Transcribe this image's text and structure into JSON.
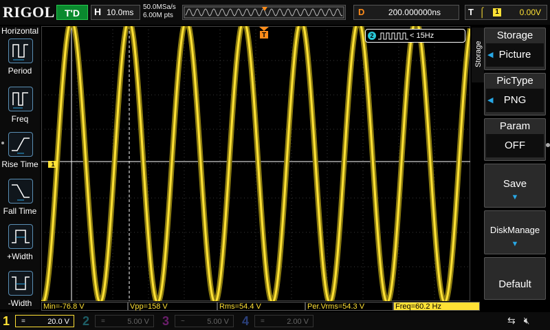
{
  "brand": "RIGOL",
  "run_status": "T'D",
  "horizontal": {
    "label": "H",
    "timebase": "10.0ms"
  },
  "acquisition": {
    "sample_rate": "50.0MSa/s",
    "memory_depth": "6.00M pts"
  },
  "delay": {
    "label": "D",
    "value": "200.000000ns"
  },
  "trigger": {
    "label": "T",
    "edge": "rising",
    "source": "1",
    "level": "0.00V"
  },
  "left_menu": {
    "title": "Horizontal",
    "items": [
      {
        "label": "Period",
        "icon": "period-icon"
      },
      {
        "label": "Freq",
        "icon": "frequency-icon"
      },
      {
        "label": "Rise Time",
        "icon": "rise-time-icon"
      },
      {
        "label": "Fall Time",
        "icon": "fall-time-icon"
      },
      {
        "label": "+Width",
        "icon": "positive-width-icon"
      },
      {
        "label": "-Width",
        "icon": "negative-width-icon"
      }
    ]
  },
  "screen": {
    "trigger_marker": "T",
    "ch1_marker": "1",
    "ch2_counter": {
      "channel": "2",
      "text": "< 15Hz"
    }
  },
  "right_menu": {
    "tab": "Storage",
    "storage": {
      "title": "Storage",
      "value": "Picture"
    },
    "pictype": {
      "title": "PicType",
      "value": "PNG"
    },
    "param": {
      "title": "Param",
      "value": "OFF"
    },
    "save": "Save",
    "disk": "DiskManage",
    "default": "Default"
  },
  "measurements": [
    {
      "text": "Min=-76.8 V",
      "highlight": false
    },
    {
      "text": "Vpp=158 V",
      "highlight": false
    },
    {
      "text": "Rms=54.4 V",
      "highlight": false
    },
    {
      "text": "Per.Vrms=54.3 V",
      "highlight": false
    },
    {
      "text": "Freq=60.2 Hz",
      "highlight": true
    }
  ],
  "channels": [
    {
      "num": "1",
      "coupling": "=",
      "scale": "20.0 V",
      "active": true,
      "color": "#ffe135"
    },
    {
      "num": "2",
      "coupling": "=",
      "scale": "5.00 V",
      "active": false,
      "color": "#28c6d6"
    },
    {
      "num": "3",
      "coupling": "~",
      "scale": "5.00 V",
      "active": false,
      "color": "#d62dd6"
    },
    {
      "num": "4",
      "coupling": "=",
      "scale": "2.00 V",
      "active": false,
      "color": "#3b6fe6"
    }
  ],
  "colors": {
    "ch1": "#ffe135",
    "ch2": "#28c6d6",
    "accent": "#28a8e6",
    "delay": "#ff8c1a"
  }
}
